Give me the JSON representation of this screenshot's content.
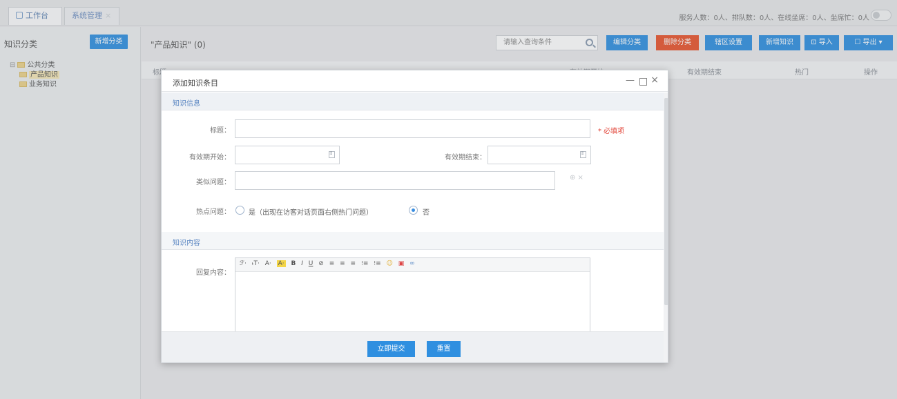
{
  "tabs": [
    {
      "label": "工作台"
    },
    {
      "label": "系统管理",
      "close": "×"
    }
  ],
  "stats_text": "服务人数：0人、排队数：0人、在线坐席：0人、坐席忙：0人",
  "sidebar": {
    "title": "知识分类",
    "new_category": "新增分类",
    "tree": {
      "root": "公共分类",
      "toggle": "⊟",
      "children": [
        "产品知识",
        "业务知识"
      ]
    }
  },
  "main": {
    "title": "\"产品知识\"  (0)",
    "search_placeholder": "请输入查询条件",
    "buttons": {
      "edit": "编辑分类",
      "delete": "删除分类",
      "area": "辖区设置",
      "new_knowledge": "新增知识",
      "import": "⊡ 导入",
      "export": "☐ 导出 ▾"
    },
    "columns": [
      "标题",
      "有效期开始",
      "有效期结束",
      "热门",
      "操作"
    ]
  },
  "modal": {
    "title": "添加知识条目",
    "controls": {
      "minimize": "—",
      "close": "×"
    },
    "section_info": "知识信息",
    "labels": {
      "title": "标题：",
      "start": "有效期开始：",
      "end": "有效期结束：",
      "similar": "类似问题：",
      "hot": "热点问题："
    },
    "required": "* 必填项",
    "similar_actions": "⊕ ×",
    "hot_options": {
      "yes": "是（出现在访客对话页面右侧热门问题）",
      "no": "否",
      "selected": "no"
    },
    "section_content": "知识内容",
    "answer_label": "回复内容：",
    "toolbar": [
      "ℱ·",
      "ₜT·",
      "A·",
      "A·",
      "B",
      "I",
      "U",
      "⊘",
      "≡",
      "≡",
      "≡",
      "⁝≡",
      "⁝≡",
      "☺",
      "▣",
      "∞"
    ],
    "submit": "立即提交",
    "reset": "重置"
  }
}
